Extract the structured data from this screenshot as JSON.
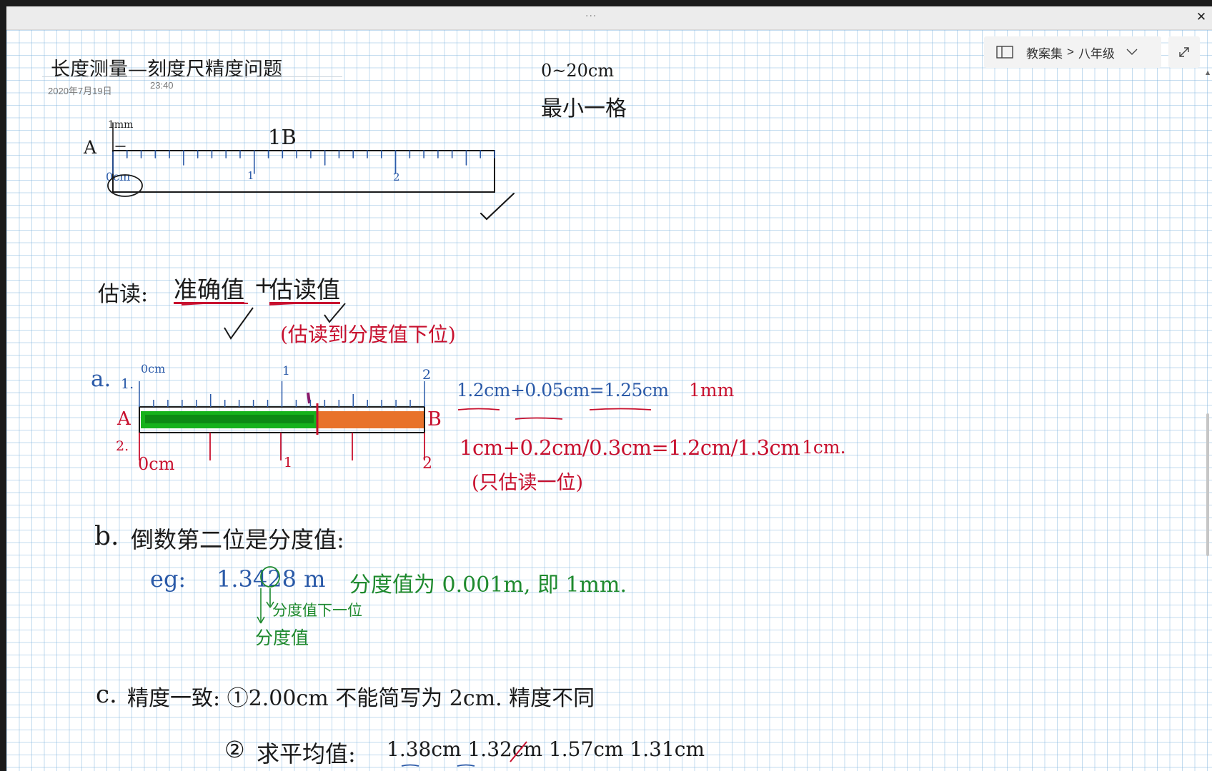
{
  "window": {
    "grip": "···",
    "close": "✕"
  },
  "breadcrumb": {
    "notebook": "教案集",
    "separator": ">",
    "section": "八年级",
    "book_icon": "book-icon",
    "chevron_icon": "chevron-down-icon"
  },
  "expand": {
    "icon": "expand-icon"
  },
  "page": {
    "title": "长度测量—刻度尺精度问题",
    "date": "2020年7月19日",
    "time": "23:40"
  },
  "notes": {
    "range": "0~20cm",
    "min_div": "最小一格",
    "ruler1": {
      "top_label": "1mm",
      "A": "A",
      "B": "1B",
      "zero": "0cm",
      "one": "1",
      "two": "2"
    },
    "estimate_label": "估读:",
    "accurate": "准确值",
    "plus": "+",
    "estimated": "估读值",
    "estimate_note": "(估读到分度值下位)",
    "a_label": "a.",
    "r1_num": "1.",
    "r1_zero": "0cm",
    "r1_one": "1",
    "r1_two": "2",
    "r2_num": "2.",
    "r2_zero": "0cm",
    "r2_one": "1",
    "r2_two": "2",
    "letter_A": "A",
    "letter_B": "B",
    "eq1": "1.2cm+0.05cm=1.25cm",
    "eq1_unit": "1mm",
    "eq2": "1cm+0.2cm/0.3cm=1.2cm/1.3cm",
    "eq2_unit": "1cm.",
    "eq2_note": "(只估读一位)",
    "b_label": "b.",
    "b_text": "倒数第二位是分度值:",
    "eg": "eg:",
    "eg_value": "1.3428 m",
    "eg_res": "分度值为 0.001m, 即 1mm.",
    "eg_next": "分度值下一位",
    "eg_div": "分度值",
    "c_label": "c.",
    "c_text": "精度一致: ①2.00cm 不能简写为 2cm. 精度不同",
    "c2_num": "②",
    "c2_label": "求平均值:",
    "c2_values": "1.38cm 1.32cm 1.57cm 1.31cm"
  },
  "colors": {
    "black_ink": "#1a1a1a",
    "red_ink": "#c8102e",
    "blue_ink": "#2b5aa8",
    "green_ink": "#1f8a2e",
    "highlight_green": "#16b21b",
    "highlight_orange": "#e8722a"
  }
}
